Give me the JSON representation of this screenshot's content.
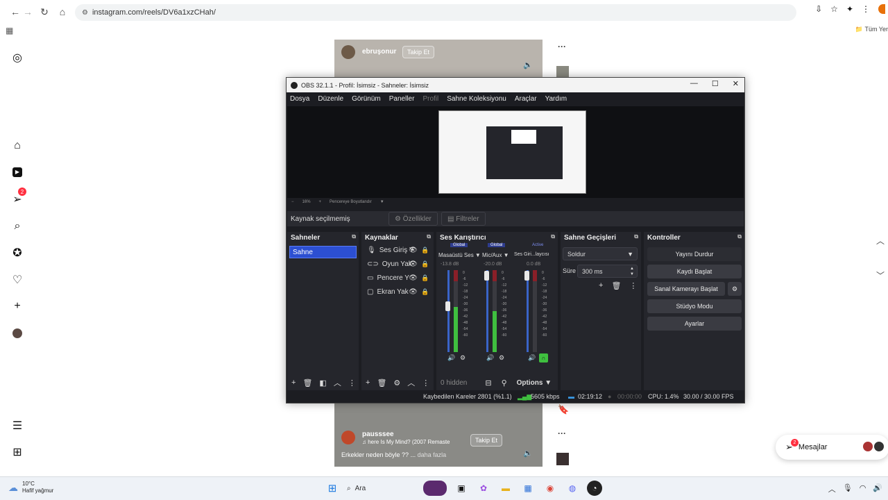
{
  "browser": {
    "url": "instagram.com/reels/DV6a1xzCHah/",
    "all_bookmarks": "Tüm Yer"
  },
  "instagram": {
    "nav": [
      {
        "name": "instagram-logo-icon"
      },
      {
        "name": "home-icon"
      },
      {
        "name": "reels-icon"
      },
      {
        "name": "messages-icon",
        "badge": "2"
      },
      {
        "name": "search-icon"
      },
      {
        "name": "explore-icon"
      },
      {
        "name": "notifications-icon"
      },
      {
        "name": "create-icon"
      },
      {
        "name": "profile-avatar"
      }
    ],
    "reel_top": {
      "username": "ebruşonur",
      "follow": "Takip Et"
    },
    "reel_bottom": {
      "username": "pausssee",
      "song": "here Is My Mind? (2007 Remaste",
      "follow": "Takip Et",
      "caption": "Erkekler neden böyle ?? ...",
      "more": "daha fazla"
    },
    "messages": {
      "label": "Mesajlar",
      "badge": "2"
    }
  },
  "obs": {
    "title": "OBS 32.1.1 - Profil: İsimsiz - Sahneler: İsimsiz",
    "menu": [
      "Dosya",
      "Düzenle",
      "Görünüm",
      "Paneller",
      "Profil",
      "Sahne Koleksiyonu",
      "Araçlar",
      "Yardım"
    ],
    "zoom": {
      "value": "16%",
      "fit": "Pencereye Boyutlandır"
    },
    "source_bar": {
      "label": "Kaynak seçilmemiş",
      "properties": "Özellikler",
      "filters": "Filtreler"
    },
    "scenes": {
      "title": "Sahneler",
      "items": [
        "Sahne"
      ]
    },
    "sources": {
      "title": "Kaynaklar",
      "items": [
        {
          "label": "Ses Giriş Y",
          "icon": "mic-icon"
        },
        {
          "label": "Oyun Yak",
          "icon": "gamepad-icon"
        },
        {
          "label": "Pencere Y",
          "icon": "window-icon"
        },
        {
          "label": "Ekran Yak",
          "icon": "monitor-icon"
        }
      ]
    },
    "mixer": {
      "title": "Ses Karıştırıcı",
      "tags": [
        "Global",
        "Global",
        "Active"
      ],
      "channels": [
        {
          "name": "Masaüstü Ses",
          "db": "-13.8 dB",
          "level": 0.55
        },
        {
          "name": "Mic/Aux",
          "db": "-20.0 dB",
          "level": 0.5
        },
        {
          "name": "Ses Giri...laycısı",
          "db": "0.0 dB",
          "level": 0.0
        }
      ],
      "ticks": [
        "0",
        "-6",
        "-12",
        "-18",
        "-24",
        "-30",
        "-36",
        "-42",
        "-48",
        "-54",
        "-60"
      ],
      "hidden": "0 hidden",
      "options": "Options"
    },
    "transitions": {
      "title": "Sahne Geçişleri",
      "type": "Soldur",
      "duration_label": "Süre",
      "duration": "300 ms"
    },
    "controls": {
      "title": "Kontroller",
      "stop_stream": "Yayını Durdur",
      "start_recording": "Kaydı Başlat",
      "start_virtual_cam": "Sanal Kamerayı Başlat",
      "studio_mode": "Stüdyo Modu",
      "settings": "Ayarlar"
    },
    "status": {
      "dropped": "Kaybedilen Kareler 2801 (%1.1)",
      "bitrate": "5605 kbps",
      "stream_time": "02:19:12",
      "rec_time": "00:00:00",
      "cpu": "CPU: 1.4%",
      "fps": "30.00 / 30.00 FPS"
    }
  },
  "taskbar": {
    "weather_temp": "10°C",
    "weather_desc": "Hafif yağmur",
    "search_placeholder": "Ara"
  },
  "colors": {
    "obs_bg": "#1c1d22",
    "obs_dock": "#25262c",
    "selected_scene": "#2c4fd2",
    "badge": "#ff3040"
  }
}
